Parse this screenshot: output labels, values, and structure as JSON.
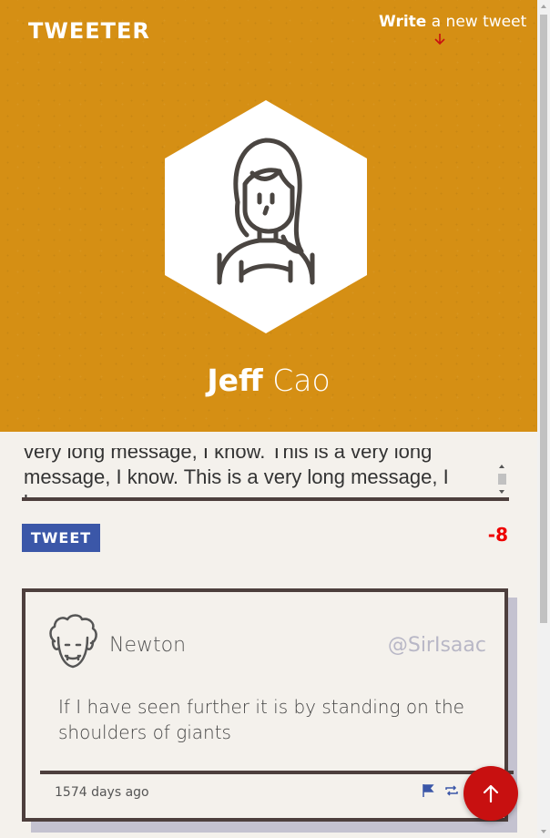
{
  "header": {
    "logo": "TWEETER",
    "write_bold": "Write",
    "write_rest": " a new tweet",
    "user_first": "Jeff",
    "user_last": " Cao"
  },
  "compose": {
    "text": "very long message, I know. This is a very long message, I know. This is a very long message, I know.",
    "button_label": "TWEET",
    "counter": "-8"
  },
  "tweet": {
    "name": "Newton",
    "handle": "@SirIsaac",
    "body": "If I have seen further it is by standing on the shoulders of giants",
    "time": "1574 days ago",
    "actions": [
      "flag-icon",
      "retweet-icon",
      "heart-icon"
    ]
  },
  "colors": {
    "header_bg": "#d58f14",
    "accent_red": "#c81010",
    "tweet_button": "#3b57a8",
    "dark_border": "#4d3f3d"
  }
}
